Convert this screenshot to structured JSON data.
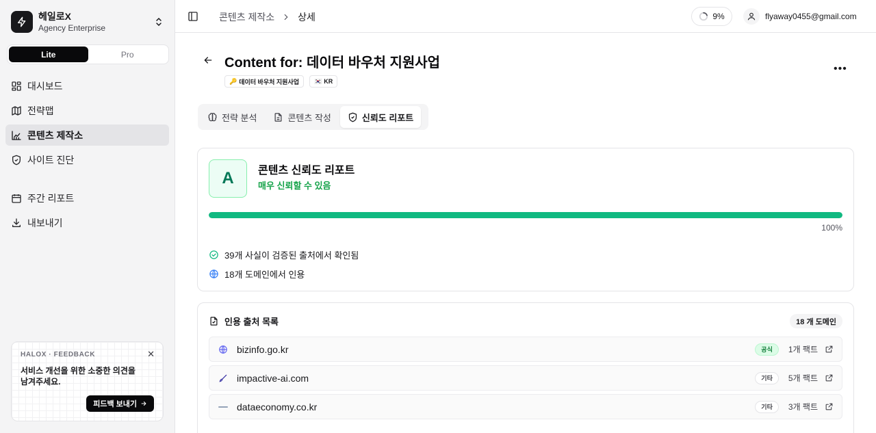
{
  "sidebar": {
    "org_name": "헤일로X",
    "org_plan": "Agency Enterprise",
    "plan_toggle": {
      "lite": "Lite",
      "pro": "Pro"
    },
    "nav": [
      {
        "label": "대시보드"
      },
      {
        "label": "전략맵"
      },
      {
        "label": "콘텐츠 제작소"
      },
      {
        "label": "사이트 진단"
      },
      {
        "label": "주간 리포트"
      },
      {
        "label": "내보내기"
      }
    ],
    "feedback": {
      "kicker": "HALOX · FEEDBACK",
      "message": "서비스 개선을 위한 소중한 의견을 남겨주세요.",
      "button": "피드백 보내기"
    }
  },
  "header": {
    "breadcrumb": [
      "콘텐츠 제작소",
      "상세"
    ],
    "usage": "9%",
    "usage_progress": 0.09,
    "user_email": "flyaway0455@gmail.com"
  },
  "page": {
    "title": "Content for: 데이터 바우처 지원사업",
    "tags": [
      {
        "icon": "🔑",
        "label": "데이터 바우처 지원사업"
      },
      {
        "icon": "🇰🇷",
        "label": "KR"
      }
    ],
    "tabs": [
      {
        "label": "전략 분석"
      },
      {
        "label": "콘텐츠 작성"
      },
      {
        "label": "신뢰도 리포트"
      }
    ]
  },
  "report": {
    "grade": "A",
    "title": "콘텐츠 신뢰도 리포트",
    "subtitle": "매우 신뢰할 수 있음",
    "progress_percent": 100,
    "progress_label": "100%",
    "facts": [
      "39개 사실이 검증된 출처에서 확인됨",
      "18개 도메인에서 인용"
    ]
  },
  "sources": {
    "title": "인용 출처 목록",
    "count_label": "18 개 도메인",
    "items": [
      {
        "domain": "bizinfo.go.kr",
        "badge": "공식",
        "facts": "1개 팩트"
      },
      {
        "domain": "impactive-ai.com",
        "badge": "기타",
        "facts": "5개 팩트"
      },
      {
        "domain": "dataeconomy.co.kr",
        "badge": "기타",
        "facts": "3개 팩트"
      }
    ]
  },
  "colors": {
    "accent_green": "#10b981",
    "grade_text": "#047857",
    "subtitle_green": "#16a34a",
    "active_toggle": "#09090b"
  }
}
